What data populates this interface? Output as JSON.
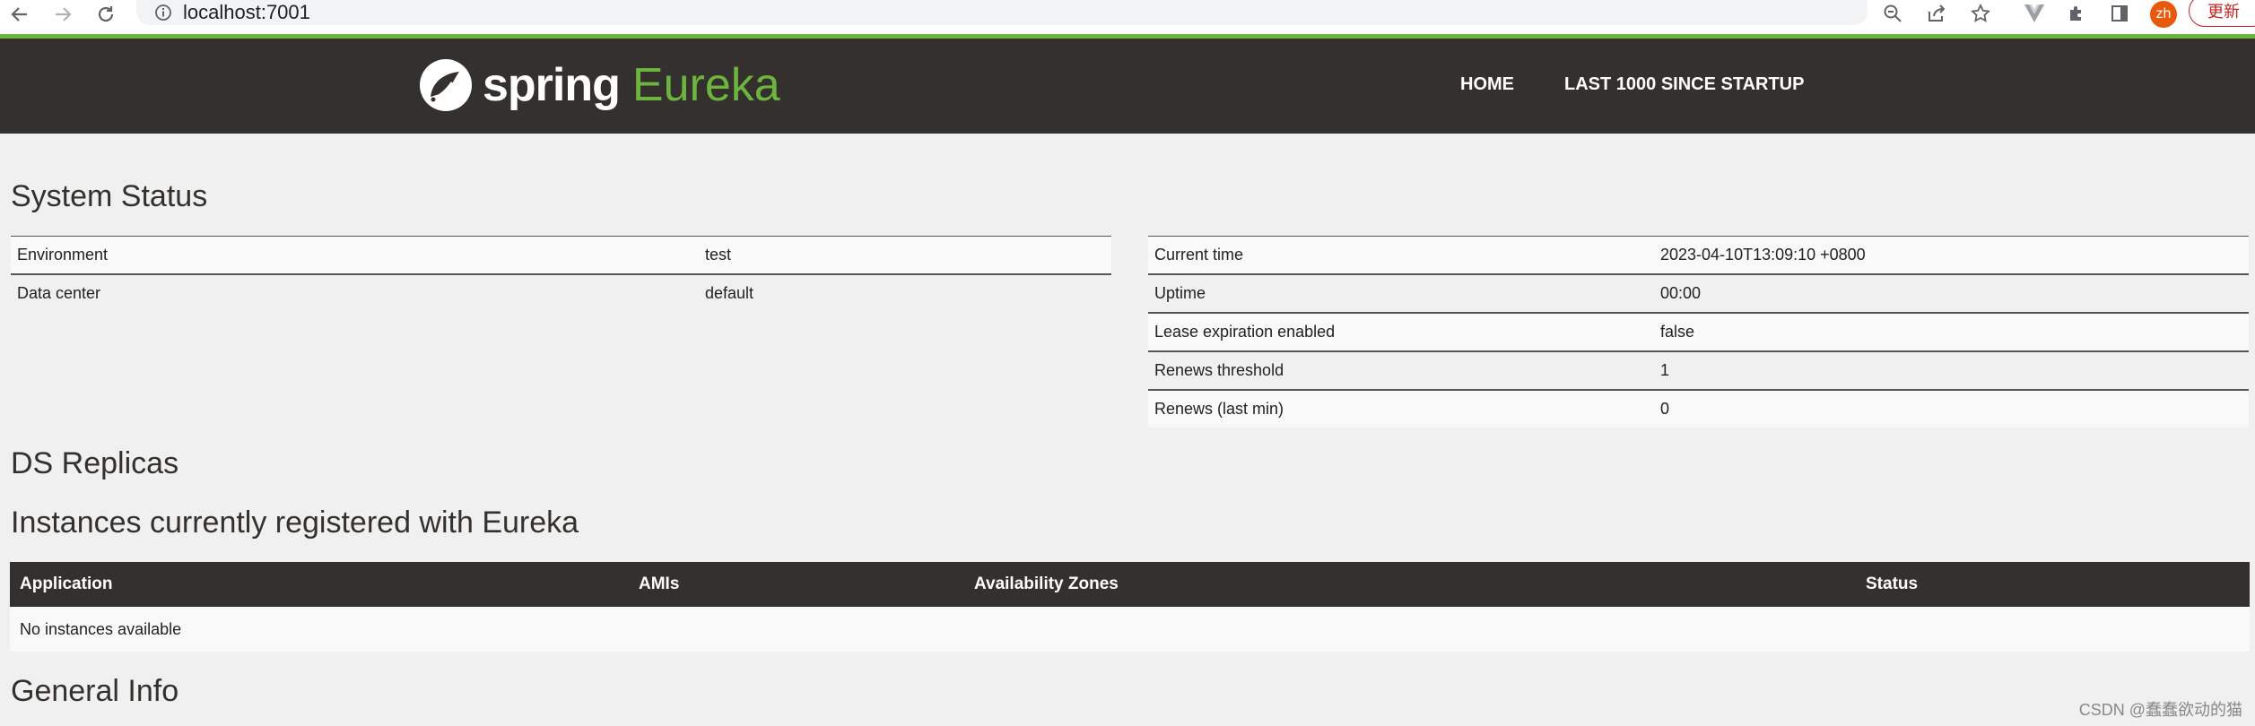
{
  "browser": {
    "url": "localhost:7001",
    "profile_initials": "zh",
    "update_label": "更新"
  },
  "header": {
    "logo_word1": "spring",
    "logo_word2": "Eureka",
    "nav": {
      "home": "HOME",
      "last1000": "LAST 1000 SINCE STARTUP"
    }
  },
  "system_status": {
    "title": "System Status",
    "left": [
      {
        "label": "Environment",
        "value": "test"
      },
      {
        "label": "Data center",
        "value": "default"
      }
    ],
    "right": [
      {
        "label": "Current time",
        "value": "2023-04-10T13:09:10 +0800"
      },
      {
        "label": "Uptime",
        "value": "00:00"
      },
      {
        "label": "Lease expiration enabled",
        "value": "false"
      },
      {
        "label": "Renews threshold",
        "value": "1"
      },
      {
        "label": "Renews (last min)",
        "value": "0"
      }
    ]
  },
  "ds_replicas": {
    "title": "DS Replicas"
  },
  "instances": {
    "title": "Instances currently registered with Eureka",
    "columns": [
      "Application",
      "AMIs",
      "Availability Zones",
      "Status"
    ],
    "empty_message": "No instances available"
  },
  "general_info": {
    "title": "General Info"
  },
  "watermark": "CSDN @蠢蠢欲动的猫",
  "colors": {
    "brand_green": "#6db33f",
    "header_dark": "#34302d",
    "page_bg": "#f0f0f0"
  }
}
